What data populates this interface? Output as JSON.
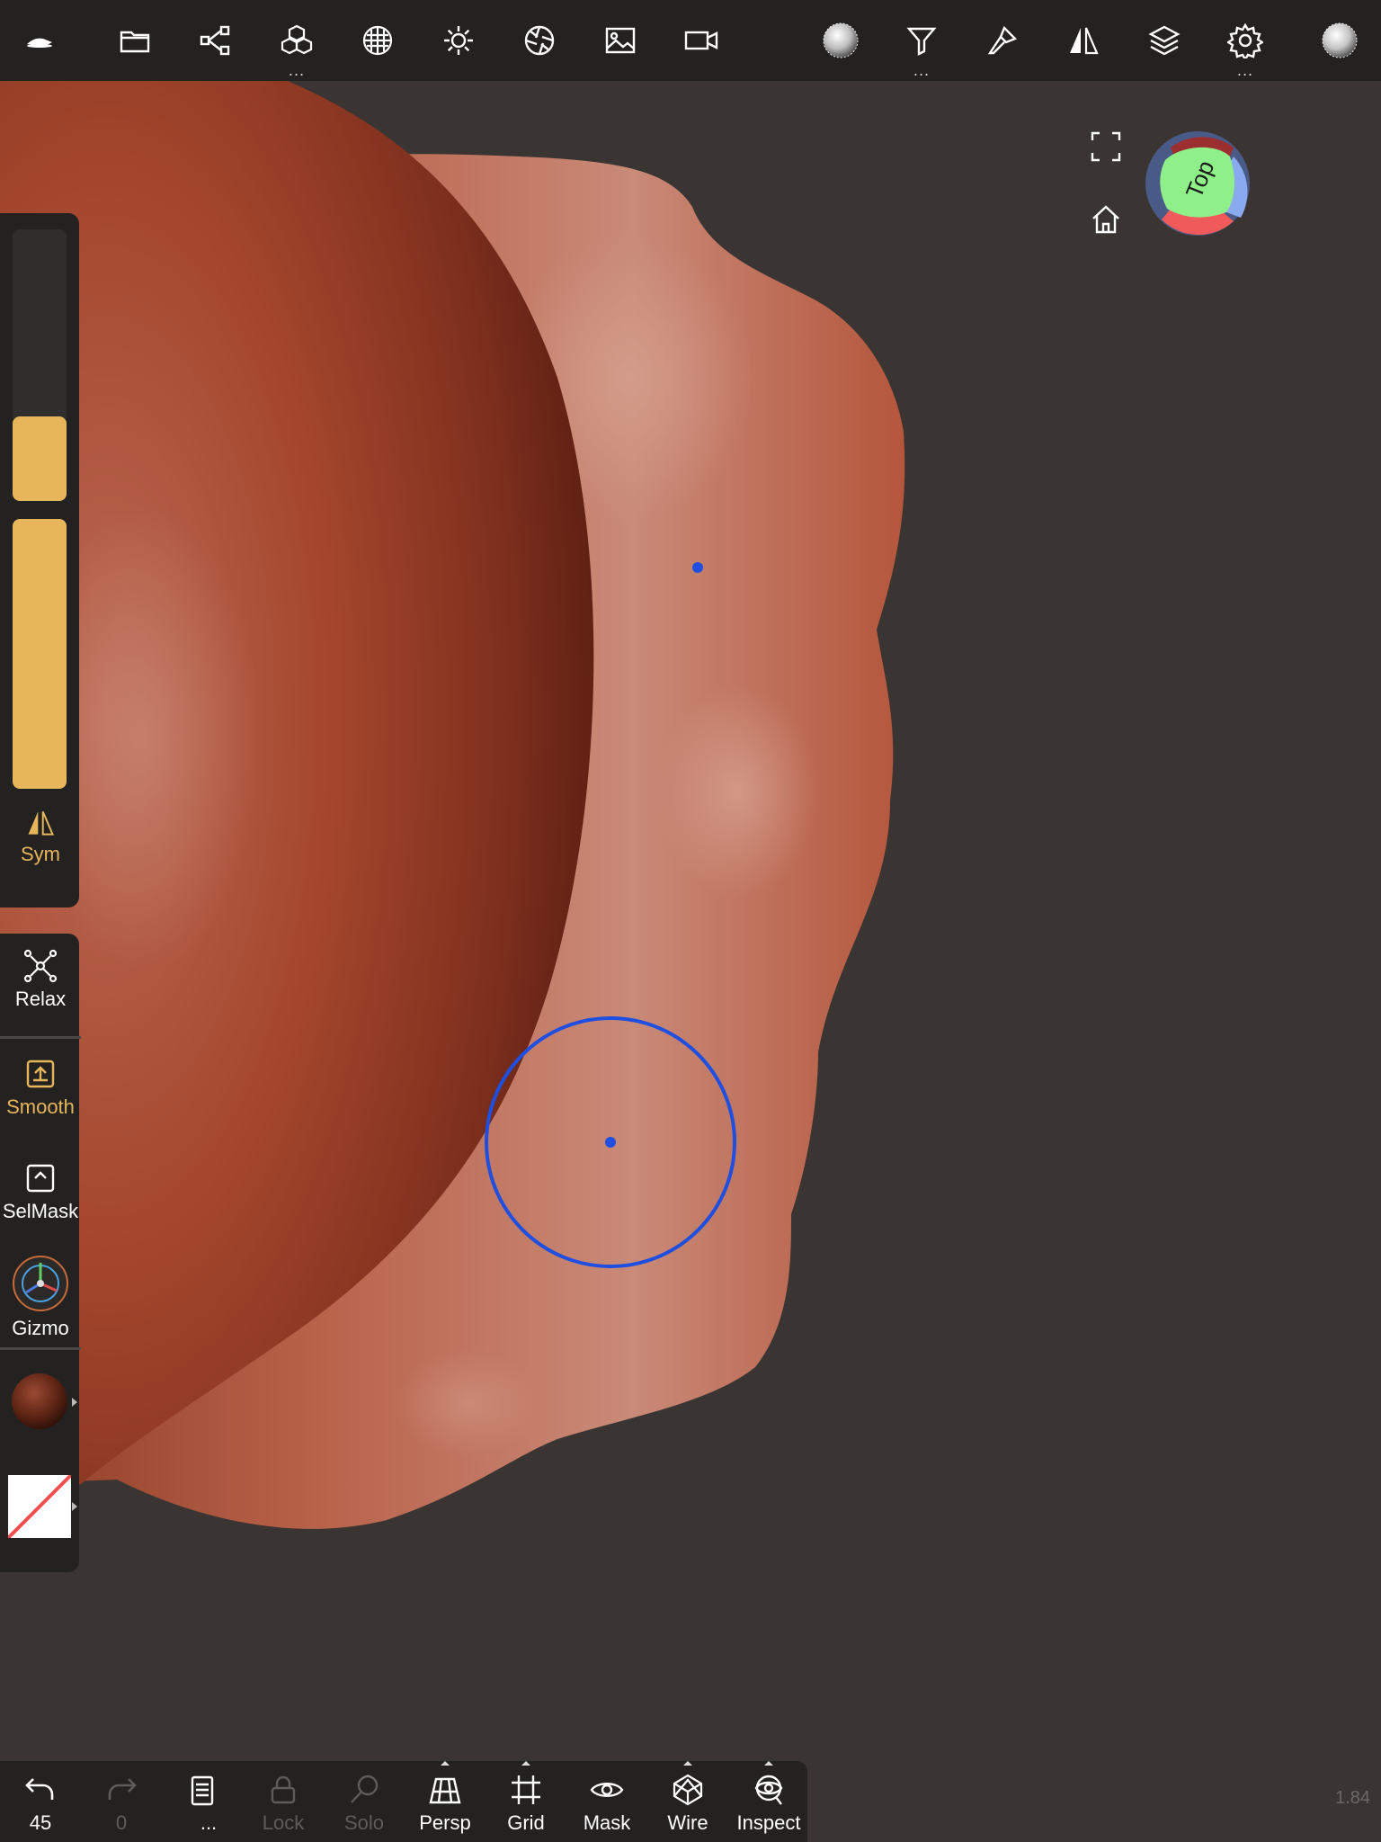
{
  "toolbar": {
    "items": [
      {
        "name": "logo-icon"
      },
      {
        "name": "folder-icon"
      },
      {
        "name": "scene-graph-icon"
      },
      {
        "name": "primitives-icon",
        "more": "..."
      },
      {
        "name": "topology-icon"
      },
      {
        "name": "light-icon"
      },
      {
        "name": "camera-aperture-icon"
      },
      {
        "name": "image-icon"
      },
      {
        "name": "video-camera-icon"
      },
      {
        "name": "matcap-icon"
      },
      {
        "name": "filter-icon",
        "more": "..."
      },
      {
        "name": "brush-icon"
      },
      {
        "name": "symmetry-icon"
      },
      {
        "name": "layers-icon"
      },
      {
        "name": "settings-icon",
        "more": "..."
      },
      {
        "name": "material-preview-icon"
      }
    ],
    "more_dots": "..."
  },
  "view_cube": {
    "label": "Top"
  },
  "left_panel": {
    "radius_level": 0.2,
    "intensity_level": 1.0,
    "sym_label": "Sym",
    "tools": {
      "relax": "Relax",
      "smooth": "Smooth",
      "selmask": "SelMask",
      "gizmo": "Gizmo"
    },
    "accent_color": "#e8b65a"
  },
  "bottom_bar": {
    "undo_count": "45",
    "redo_count": "0",
    "more_label": "...",
    "lock_label": "Lock",
    "solo_label": "Solo",
    "persp_label": "Persp",
    "grid_label": "Grid",
    "mask_label": "Mask",
    "wire_label": "Wire",
    "inspect_label": "Inspect"
  },
  "version": "1.84",
  "brush_cursor_color": "#1e4fe0"
}
